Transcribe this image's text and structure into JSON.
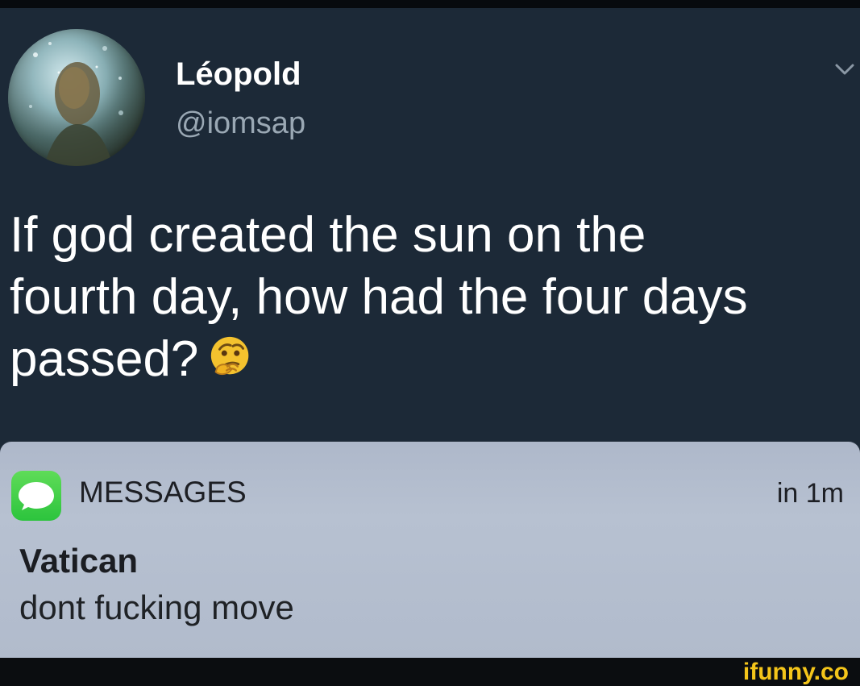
{
  "profile": {
    "display_name": "Léopold",
    "handle": "@iomsap",
    "avatar_icon": "profile-photo",
    "more_icon": "chevron-down-icon"
  },
  "tweet": {
    "lines": [
      "If god created the sun on the",
      "fourth day, how had the four days",
      "passed?"
    ],
    "emoji_icon": "thinking-face-emoji"
  },
  "notification": {
    "app_name": "MESSAGES",
    "time": "in 1m",
    "sender": "Vatican",
    "message": "dont fucking move",
    "app_icon": "messages-icon"
  },
  "watermark": {
    "text": "ifunny.co"
  },
  "colors": {
    "tweet_background": "#1c2937",
    "notification_background": "#b1bbcc",
    "messages_green": "#2cc43d",
    "watermark_yellow": "#f4c51a"
  }
}
